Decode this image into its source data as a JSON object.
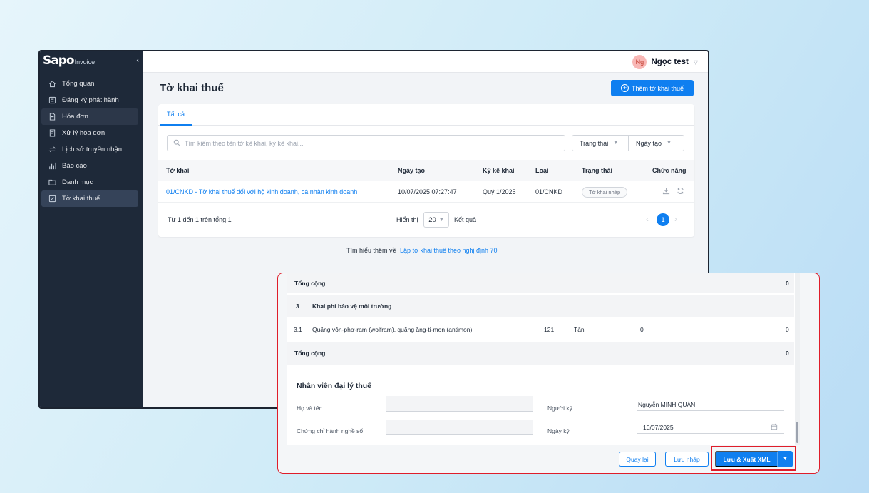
{
  "app": {
    "logo_main": "Sapo",
    "logo_sub": "Invoice",
    "collapse_icon": "‹"
  },
  "sidebar": {
    "items": [
      {
        "label": "Tổng quan",
        "icon": "home-icon"
      },
      {
        "label": "Đăng ký phát hành",
        "icon": "register-icon"
      },
      {
        "label": "Hóa đơn",
        "icon": "invoice-icon"
      },
      {
        "label": "Xử lý hóa đơn",
        "icon": "process-invoice-icon"
      },
      {
        "label": "Lịch sử truyền nhận",
        "icon": "transfer-history-icon"
      },
      {
        "label": "Báo cáo",
        "icon": "report-chart-icon"
      },
      {
        "label": "Danh mục",
        "icon": "folder-icon"
      },
      {
        "label": "Tờ khai thuế",
        "icon": "tax-form-icon"
      }
    ],
    "active_index": 7,
    "highlight_index": 2
  },
  "user": {
    "avatar": "Ng",
    "name": "Ngọc test"
  },
  "page": {
    "title": "Tờ khai thuế",
    "add_button": "Thêm tờ khai thuế",
    "tab_all": "Tất cả",
    "search_placeholder": "Tìm kiếm theo tên tờ kê khai, kỳ kê khai...",
    "filter_status": "Trạng thái",
    "filter_created": "Ngày tạo",
    "columns": [
      "Tờ khai",
      "Ngày tạo",
      "Kỳ kê khai",
      "Loại",
      "Trạng thái",
      "Chức năng"
    ],
    "row": {
      "name": "01/CNKD - Tờ khai thuế đối với hộ kinh doanh, cá nhân kinh doanh",
      "created": "10/07/2025 07:27:47",
      "period": "Quý 1/2025",
      "type": "01/CNKD",
      "status": "Tờ khai nháp"
    },
    "pager": {
      "summary": "Từ 1 đến 1 trên tổng 1",
      "show_label": "Hiển thị",
      "page_size": "20",
      "result_label": "Kết quả",
      "current_page": "1"
    },
    "learn_more_prefix": "Tìm hiểu thêm về",
    "learn_more_link": "Lập tờ khai thuế theo nghị định 70"
  },
  "form": {
    "total_label": "Tổng cộng",
    "total_value_1": "0",
    "section_no": "3",
    "section_title": "Khai phí bảo vệ môi trường",
    "item": {
      "no": "3.1",
      "name": "Quặng vôn-phơ-ram (wolfram), quặng ăng-ti-mon (antimon)",
      "code": "121",
      "unit": "Tấn",
      "qty": "0",
      "amount": "0"
    },
    "total_label_2": "Tổng cộng",
    "total_value_2": "0",
    "agent_section": "Nhân viên đại lý thuế",
    "full_name_label": "Họ và tên",
    "cert_label": "Chứng chỉ hành nghề số",
    "signer_label": "Người ký",
    "signer_value": "Nguyễn MINH QUÂN",
    "sign_date_label": "Ngày ký",
    "sign_date_value": "10/07/2025",
    "back_button": "Quay lại",
    "draft_button": "Lưu nháp",
    "save_export_button": "Lưu & Xuất XML"
  },
  "colors": {
    "primary": "#0f7ff0",
    "sidebar_bg": "#1e2939",
    "highlight_red": "#df1d2a"
  }
}
